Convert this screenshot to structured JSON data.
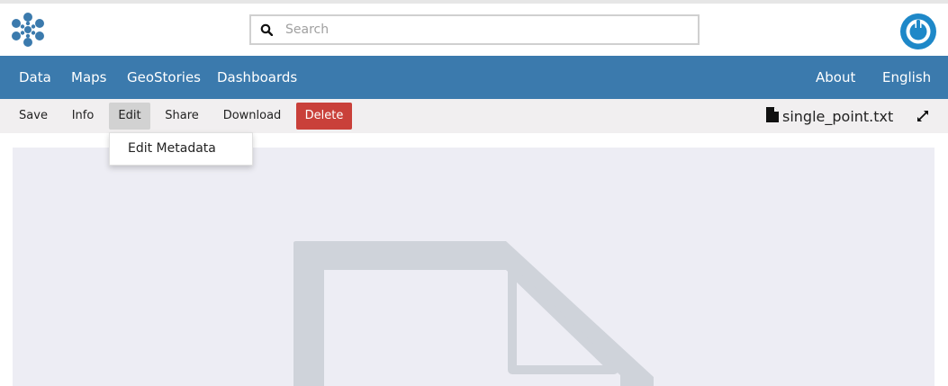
{
  "header": {
    "search": {
      "placeholder": "Search"
    }
  },
  "nav": {
    "items": [
      "Data",
      "Maps",
      "GeoStories",
      "Dashboards"
    ],
    "right": [
      "About",
      "English"
    ]
  },
  "toolbar": {
    "buttons": {
      "save": "Save",
      "info": "Info",
      "edit": "Edit",
      "share": "Share",
      "download": "Download",
      "delete": "Delete"
    },
    "filename": "single_point.txt"
  },
  "dropdown": {
    "items": [
      "Edit Metadata"
    ]
  },
  "colors": {
    "brand": "#3b7aad",
    "danger": "#c9403a",
    "toolbar_bg": "#f1eff0",
    "preview_bg": "#ededf4",
    "placeholder_icon": "#cfd3da"
  },
  "icons": {
    "logo": "geonode-logo-icon",
    "search": "search-icon",
    "power": "power-icon",
    "file": "file-icon",
    "expand": "expand-icon",
    "preview": "file-placeholder-icon"
  }
}
